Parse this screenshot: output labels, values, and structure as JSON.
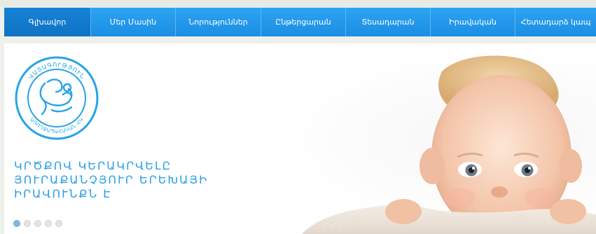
{
  "nav": {
    "items": [
      {
        "label": "Գլխավոր",
        "active": true
      },
      {
        "label": "Մեր Մասին",
        "active": false
      },
      {
        "label": "Նորություններ",
        "active": false
      },
      {
        "label": "Ընթերցարան",
        "active": false
      },
      {
        "label": "Տեսադարան",
        "active": false
      },
      {
        "label": "Իրավական",
        "active": false
      },
      {
        "label": "Հետադարձ կապ",
        "active": false
      }
    ]
  },
  "slider": {
    "logo": {
      "top_text": "ՎԱՏԱԳՈՒԹՅՈՒՆ",
      "bottom_text": "ԱՌՈՂՋԱՊԱՀԱԿԱՆ ՀԿ"
    },
    "tagline": [
      "ԿՐԾՔՈՎ ԿԵՐԱԿՐՎԵԼԸ",
      "ՅՈՒՐԱՔԱՆՉՅՈՒՐ ԵՐԵԽԱՅԻ",
      "ԻՐԱՎՈՒՆՔՆ Է"
    ],
    "dots": {
      "count": 5,
      "active_index": 0
    }
  },
  "colors": {
    "nav_bg": "#1f97ea",
    "accent": "#2a9fe8",
    "page_bg": "#eef0ec"
  }
}
